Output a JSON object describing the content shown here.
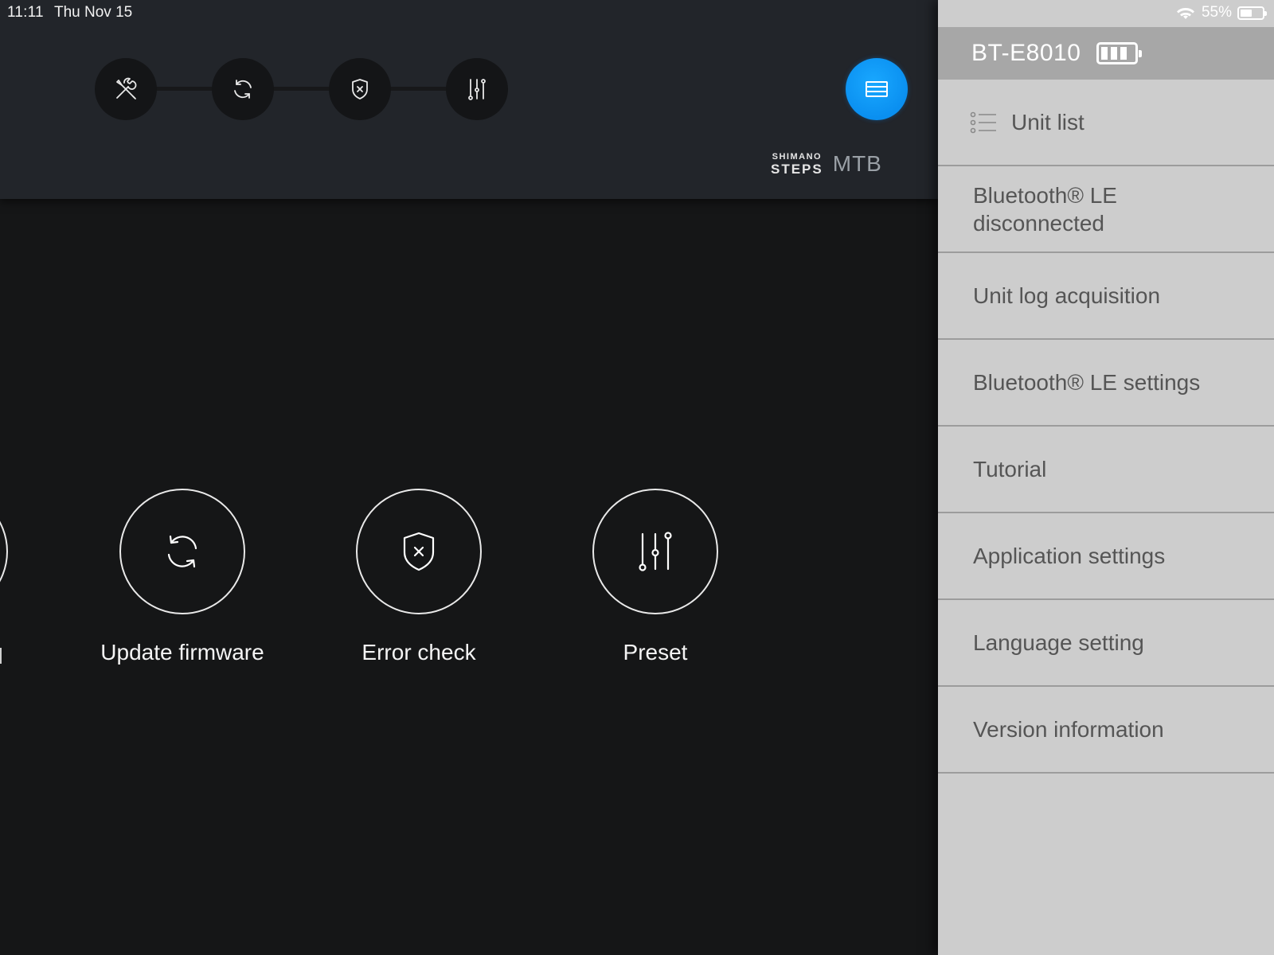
{
  "status_bar": {
    "time": "11:11",
    "date": "Thu Nov 15",
    "battery_percent": "55%",
    "battery_level": 0.55
  },
  "header": {
    "steps": [
      {
        "name": "tools",
        "icon": "wrench-screwdriver-icon"
      },
      {
        "name": "update",
        "icon": "refresh-icon"
      },
      {
        "name": "error-check",
        "icon": "shield-x-icon"
      },
      {
        "name": "preset",
        "icon": "sliders-icon"
      }
    ],
    "menu_icon": "menu-list-icon",
    "brand_logo_top": "SHIMANO",
    "brand_logo_bottom": "STEPS",
    "brand_suffix": "MTB",
    "accent_color": "#0a8ff0"
  },
  "features": [
    {
      "label": "Update firmware",
      "icon": "refresh-icon"
    },
    {
      "label": "Error check",
      "icon": "shield-x-icon"
    },
    {
      "label": "Preset",
      "icon": "sliders-icon"
    }
  ],
  "sidebar": {
    "device_name": "BT-E8010",
    "device_battery_bars": 3,
    "items": [
      {
        "label": "Unit list",
        "icon": "list-icon"
      },
      {
        "label": "Bluetooth® LE\ndisconnected"
      },
      {
        "label": "Unit log acquisition"
      },
      {
        "label": "Bluetooth® LE settings"
      },
      {
        "label": "Tutorial"
      },
      {
        "label": "Application settings"
      },
      {
        "label": "Language setting"
      },
      {
        "label": "Version information"
      }
    ]
  }
}
